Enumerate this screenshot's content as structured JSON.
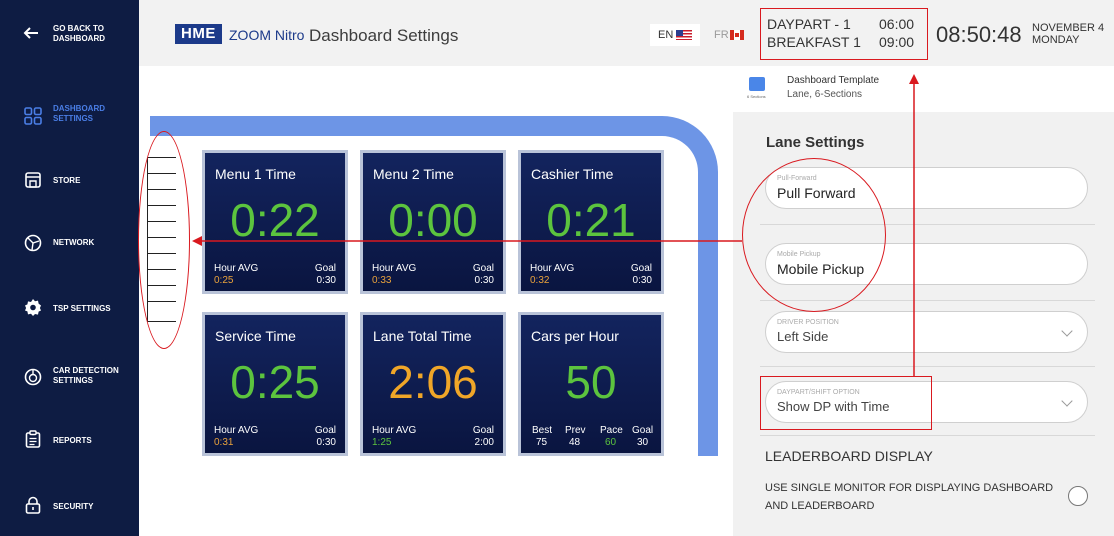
{
  "sidebar": {
    "back_label": "GO BACK TO DASHBOARD",
    "items": [
      {
        "label": "DASHBOARD SETTINGS",
        "icon": "dashboard-grid-icon",
        "active": true
      },
      {
        "label": "STORE",
        "icon": "store-icon",
        "active": false
      },
      {
        "label": "NETWORK",
        "icon": "network-icon",
        "active": false
      },
      {
        "label": "TSP SETTINGS",
        "icon": "gear-icon",
        "active": false
      },
      {
        "label": "CAR DETECTION SETTINGS",
        "icon": "car-detection-icon",
        "active": false
      },
      {
        "label": "REPORTS",
        "icon": "clipboard-icon",
        "active": false
      },
      {
        "label": "SECURITY",
        "icon": "lock-icon",
        "active": false
      }
    ]
  },
  "header": {
    "logo_brand": "HME",
    "logo_product": "ZOOM Nitro",
    "title": "Dashboard Settings",
    "lang_en": "EN",
    "lang_fr": "FR",
    "daypart": {
      "name": "DAYPART - 1",
      "start": "06:00",
      "shift": "BREAKFAST 1",
      "end": "09:00"
    },
    "clock": "08:50:48",
    "date": "NOVEMBER 4",
    "weekday": "MONDAY"
  },
  "tiles": [
    {
      "name": "Menu 1 Time",
      "value": "0:22",
      "value_color": "#5cc43e",
      "left_label": "Hour AVG",
      "left_value": "0:25",
      "left_value_color": "#e9a23b",
      "right_label": "Goal",
      "right_value": "0:30"
    },
    {
      "name": "Menu 2 Time",
      "value": "0:00",
      "value_color": "#5cc43e",
      "left_label": "Hour AVG",
      "left_value": "0:33",
      "left_value_color": "#e9a23b",
      "right_label": "Goal",
      "right_value": "0:30"
    },
    {
      "name": "Cashier Time",
      "value": "0:21",
      "value_color": "#5cc43e",
      "left_label": "Hour AVG",
      "left_value": "0:32",
      "left_value_color": "#e9a23b",
      "right_label": "Goal",
      "right_value": "0:30"
    },
    {
      "name": "Service Time",
      "value": "0:25",
      "value_color": "#5cc43e",
      "left_label": "Hour AVG",
      "left_value": "0:31",
      "left_value_color": "#e9a23b",
      "right_label": "Goal",
      "right_value": "0:30"
    },
    {
      "name": "Lane Total Time",
      "value": "2:06",
      "value_color": "#f0a628",
      "left_label": "Hour AVG",
      "left_value": "1:25",
      "left_value_color": "#5cc43e",
      "right_label": "Goal",
      "right_value": "2:00"
    },
    {
      "name": "Cars per Hour",
      "value": "50",
      "value_color": "#5cc43e",
      "stats": [
        {
          "label": "Best",
          "value": "75",
          "color": "#ffffff"
        },
        {
          "label": "Prev",
          "value": "48",
          "color": "#ffffff"
        },
        {
          "label": "Pace",
          "value": "60",
          "color": "#5cc43e"
        },
        {
          "label": "Goal",
          "value": "30",
          "color": "#ffffff"
        }
      ]
    }
  ],
  "panel": {
    "template_icon_caption": "6 Sections",
    "template_title": "Dashboard Template",
    "template_subtitle": "Lane, 6-Sections",
    "section_title": "Lane Settings",
    "fields": [
      {
        "label": "Pull-Forward",
        "value": "Pull Forward",
        "dropdown": false
      },
      {
        "label": "Mobile Pickup",
        "value": "Mobile Pickup",
        "dropdown": false
      },
      {
        "label": "DRIVER POSITION",
        "value": "Left Side",
        "dropdown": true
      },
      {
        "label": "DAYPART/SHIFT OPTION",
        "value": "Show DP with Time",
        "dropdown": true
      }
    ],
    "leaderboard_title": "LEADERBOARD DISPLAY",
    "leaderboard_desc": "USE SINGLE MONITOR FOR DISPLAYING DASHBOARD AND LEADERBOARD"
  },
  "colors": {
    "sidebar_bg": "#0e1c43",
    "active_nav": "#4a7ee6",
    "lane": "#6d95e6",
    "annotation": "#d9191f",
    "good": "#5cc43e",
    "warn": "#f0a628"
  }
}
